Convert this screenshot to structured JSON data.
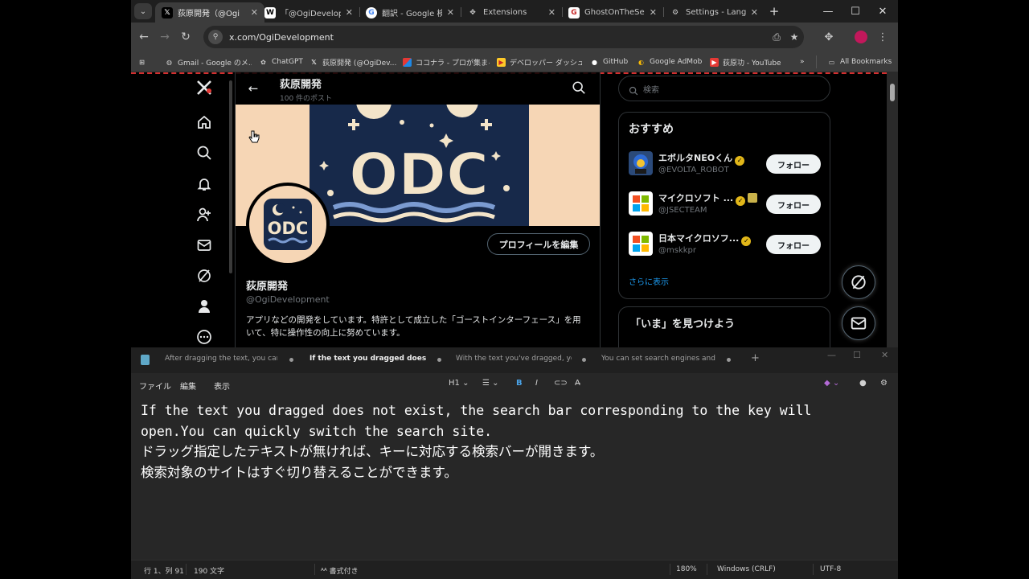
{
  "browser": {
    "tabs": [
      {
        "title": "荻原開発（@Ogi",
        "active": true
      },
      {
        "title": "「@OgiDevelopme"
      },
      {
        "title": "翻訳 - Google 検索"
      },
      {
        "title": "Extensions"
      },
      {
        "title": "GhostOnTheSearc"
      },
      {
        "title": "Settings - Langua"
      }
    ],
    "url": "x.com/OgiDevelopment",
    "bookmarks": [
      {
        "label": "Gmail - Google のメ..."
      },
      {
        "label": "ChatGPT"
      },
      {
        "label": "荻原開発 (@OgiDev..."
      },
      {
        "label": "ココナラ - プロが集まる..."
      },
      {
        "label": "デベロッパー ダッシュボ..."
      },
      {
        "label": "GitHub"
      },
      {
        "label": "Google AdMob"
      },
      {
        "label": "荻原功 - YouTube"
      }
    ],
    "bookmarks_overflow": "»",
    "all_bookmarks": "All Bookmarks"
  },
  "profile": {
    "header_name": "荻原開発",
    "post_count": "100 件のポスト",
    "name": "荻原開発",
    "handle": "@OgiDevelopment",
    "bio": "アプリなどの開発をしています。特許として成立した「ゴーストインターフェース」を用いて、特に操作性の向上に努めています。",
    "edit_button": "プロフィールを編集",
    "banner_text": "ODC",
    "avatar_text": "ODC"
  },
  "sidebar": {
    "search_placeholder": "検索",
    "recommend_title": "おすすめ",
    "recommendations": [
      {
        "name": "エボルタNEOくん",
        "handle": "@EVOLTA_ROBOT",
        "follow": "フォロー"
      },
      {
        "name": "マイクロソフト ...",
        "handle": "@JSECTEAM",
        "follow": "フォロー"
      },
      {
        "name": "日本マイクロソフ...",
        "handle": "@mskkpr",
        "follow": "フォロー"
      }
    ],
    "show_more": "さらに表示",
    "discover_title": "「いま」を見つけよう"
  },
  "notepad": {
    "tabs": [
      {
        "title": "After dragging the text, you can se"
      },
      {
        "title": "If the text you dragged does not ex",
        "active": true
      },
      {
        "title": "With the text you've dragged, you c"
      },
      {
        "title": "You can set search engines and site"
      }
    ],
    "menu": {
      "file": "ファイル",
      "edit": "編集",
      "view": "表示"
    },
    "format": {
      "heading": "H1"
    },
    "text": "If the text you dragged does not exist, the search bar corresponding to the key will\nopen.You can quickly switch the search site.\nドラッグ指定したテキストが無ければ、キーに対応する検索バーが開きます。\n検索対象のサイトはすぐ切り替えることができます。",
    "status": {
      "position": "行 1、列 91",
      "chars": "190 文字",
      "format": "書式付き",
      "zoom": "180%",
      "line_ending": "Windows (CRLF)",
      "encoding": "UTF-8"
    }
  }
}
